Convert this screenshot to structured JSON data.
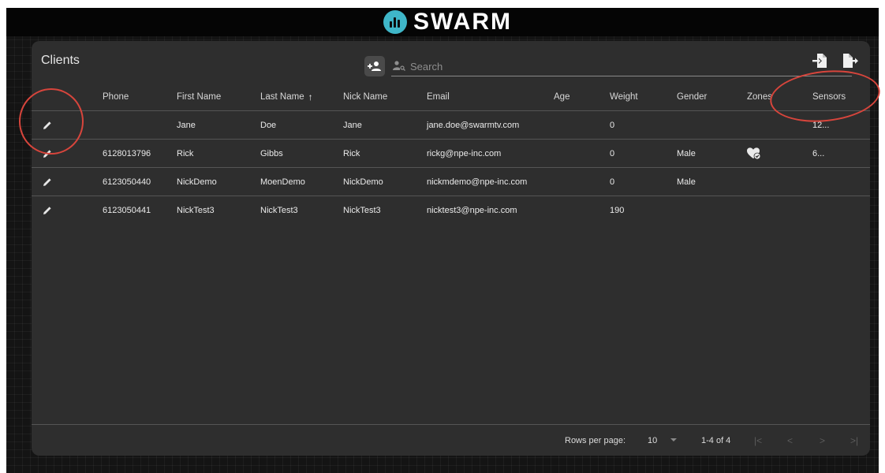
{
  "app": {
    "logo_text": "SWARM",
    "brand_color": "#3fb6c8"
  },
  "panel": {
    "title": "Clients",
    "add_client_icon": "person-add-icon",
    "search": {
      "placeholder": "Search",
      "value": "",
      "icon": "person-search-icon"
    },
    "import_icon": "file-import-icon",
    "export_icon": "file-export-icon"
  },
  "table": {
    "columns": {
      "phone": "Phone",
      "first_name": "First Name",
      "last_name": "Last Name",
      "last_name_sort": "↑",
      "nick_name": "Nick Name",
      "email": "Email",
      "age": "Age",
      "weight": "Weight",
      "gender": "Gender",
      "zones": "Zones",
      "sensors": "Sensors"
    },
    "rows": [
      {
        "phone": "",
        "first_name": "Jane",
        "last_name": "Doe",
        "nick_name": "Jane",
        "email": "jane.doe@swarmtv.com",
        "age": "",
        "weight": "0",
        "gender": "",
        "zones_icon": "",
        "sensors": "12..."
      },
      {
        "phone": "6128013796",
        "first_name": "Rick",
        "last_name": "Gibbs",
        "nick_name": "Rick",
        "email": "rickg@npe-inc.com",
        "age": "",
        "weight": "0",
        "gender": "Male",
        "zones_icon": "heart-check-icon",
        "sensors": "6..."
      },
      {
        "phone": "6123050440",
        "first_name": "NickDemo",
        "last_name": "MoenDemo",
        "nick_name": "NickDemo",
        "email": "nickmdemo@npe-inc.com",
        "age": "",
        "weight": "0",
        "gender": "Male",
        "zones_icon": "",
        "sensors": ""
      },
      {
        "phone": "6123050441",
        "first_name": "NickTest3",
        "last_name": "NickTest3",
        "nick_name": "NickTest3",
        "email": "nicktest3@npe-inc.com",
        "age": "",
        "weight": "190",
        "gender": "",
        "zones_icon": "",
        "sensors": ""
      }
    ]
  },
  "pagination": {
    "rows_per_page_label": "Rows per page:",
    "rows_per_page_value": "10",
    "range": "1-4 of 4",
    "first": "|<",
    "prev": "<",
    "next": ">",
    "last": ">|"
  },
  "annotations": {
    "color": "#d7453c"
  }
}
